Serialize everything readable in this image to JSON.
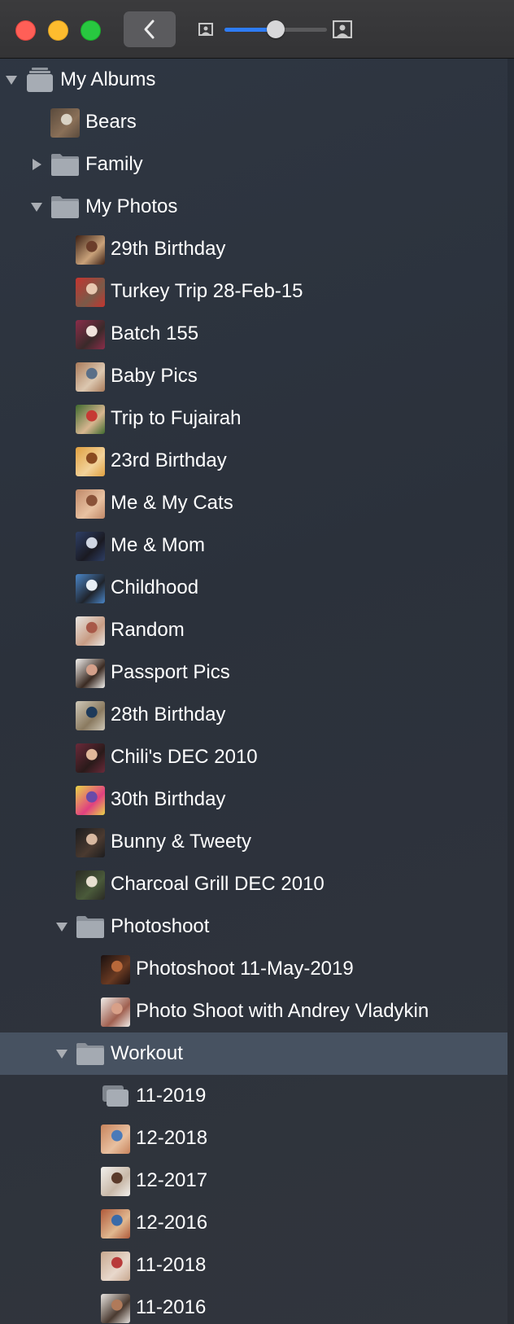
{
  "toolbar": {
    "back_icon": "chevron-left-icon",
    "zoom_small_icon": "photo-small-icon",
    "zoom_large_icon": "photo-large-icon",
    "thumbnail_size_fraction": 0.5
  },
  "tree": {
    "root": {
      "label": "My Albums",
      "icon": "albums-stack-icon",
      "expanded": true
    },
    "items": [
      {
        "label": "Bears",
        "kind": "album",
        "colors": [
          "#5a4a3c",
          "#d9d2c4",
          "#8a7058"
        ]
      },
      {
        "label": "Family",
        "kind": "folder",
        "expanded": false
      },
      {
        "label": "My Photos",
        "kind": "folder",
        "expanded": true
      },
      {
        "label": "29th Birthday",
        "kind": "album",
        "colors": [
          "#3a1f14",
          "#6b3d2a",
          "#c9a27a"
        ]
      },
      {
        "label": "Turkey Trip 28-Feb-15",
        "kind": "album",
        "colors": [
          "#c4342f",
          "#e8c8b0",
          "#7a5a48"
        ]
      },
      {
        "label": "Batch 155",
        "kind": "album",
        "colors": [
          "#8b2d4a",
          "#f0e4dc",
          "#3a2a2a"
        ]
      },
      {
        "label": "Baby Pics",
        "kind": "album",
        "colors": [
          "#a87a5a",
          "#5a6f88",
          "#dcc8b0"
        ]
      },
      {
        "label": "Trip to Fujairah",
        "kind": "album",
        "colors": [
          "#3f6a2e",
          "#c63a34",
          "#d7b690"
        ]
      },
      {
        "label": "23rd Birthday",
        "kind": "album",
        "colors": [
          "#e0a040",
          "#8a4a20",
          "#f2d29a"
        ]
      },
      {
        "label": "Me & My Cats",
        "kind": "album",
        "colors": [
          "#c08868",
          "#8a5238",
          "#e8c2a2"
        ]
      },
      {
        "label": "Me & Mom",
        "kind": "album",
        "colors": [
          "#2e3f66",
          "#d0d6e2",
          "#1a1a22"
        ]
      },
      {
        "label": "Childhood",
        "kind": "album",
        "colors": [
          "#4a86c8",
          "#e8eef4",
          "#20242c"
        ]
      },
      {
        "label": "Random",
        "kind": "album",
        "colors": [
          "#e8e6e2",
          "#a85848",
          "#c89c84"
        ]
      },
      {
        "label": "Passport Pics",
        "kind": "album",
        "colors": [
          "#f4f2ef",
          "#d4a08a",
          "#3a2a22"
        ]
      },
      {
        "label": "28th Birthday",
        "kind": "album",
        "colors": [
          "#cfc8b8",
          "#1e3a5a",
          "#8a7a60"
        ]
      },
      {
        "label": "Chili's DEC 2010",
        "kind": "album",
        "colors": [
          "#6a2a3a",
          "#e0b89a",
          "#2a1a1a"
        ]
      },
      {
        "label": "30th Birthday",
        "kind": "album",
        "colors": [
          "#e8d448",
          "#6a4aa8",
          "#e04080"
        ]
      },
      {
        "label": "Bunny & Tweety",
        "kind": "album",
        "colors": [
          "#1c1c1e",
          "#d8b8a0",
          "#4a3a30"
        ]
      },
      {
        "label": "Charcoal Grill DEC 2010",
        "kind": "album",
        "colors": [
          "#2a2a24",
          "#e8e0d0",
          "#4a5a3a"
        ]
      },
      {
        "label": "Photoshoot",
        "kind": "folder",
        "expanded": true
      },
      {
        "label": "Photoshoot 11-May-2019",
        "kind": "album",
        "colors": [
          "#1a1010",
          "#b8683a",
          "#6a3a22"
        ]
      },
      {
        "label": "Photo Shoot with Andrey Vladykin",
        "kind": "album",
        "colors": [
          "#f0ece8",
          "#d8a088",
          "#a06050"
        ]
      },
      {
        "label": "Workout",
        "kind": "folder",
        "expanded": true,
        "selected": true
      },
      {
        "label": "11-2019",
        "kind": "empty-album"
      },
      {
        "label": "12-2018",
        "kind": "album",
        "colors": [
          "#c8845c",
          "#4a7ab8",
          "#e8c0a0"
        ]
      },
      {
        "label": "12-2017",
        "kind": "album",
        "colors": [
          "#f2f0ec",
          "#5a3a2a",
          "#c8b8a8"
        ]
      },
      {
        "label": "12-2016",
        "kind": "album",
        "colors": [
          "#b05a3a",
          "#3a6aa8",
          "#e0b890"
        ]
      },
      {
        "label": "11-2018",
        "kind": "album",
        "colors": [
          "#c8a890",
          "#b83a3a",
          "#e8d8cc"
        ]
      },
      {
        "label": "11-2016",
        "kind": "album",
        "colors": [
          "#e8e4e0",
          "#b07a5a",
          "#4a3a30"
        ]
      }
    ]
  }
}
